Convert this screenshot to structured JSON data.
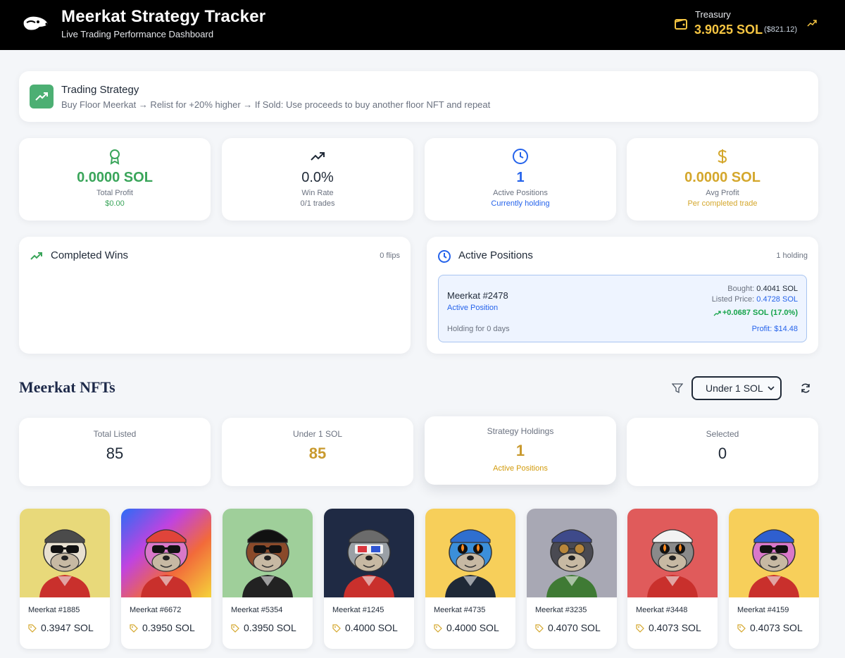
{
  "header": {
    "title": "Meerkat Strategy Tracker",
    "subtitle": "Live Trading Performance Dashboard",
    "treasury_label": "Treasury",
    "treasury_sol": "3.9025 SOL",
    "treasury_usd": "($821.12)"
  },
  "strategy": {
    "title": "Trading Strategy",
    "description": "Buy Floor Meerkat → Relist for +20% higher → If Sold: Use proceeds to buy another floor NFT and repeat"
  },
  "stats": [
    {
      "value": "0.0000 SOL",
      "label": "Total Profit",
      "sub": "$0.00",
      "icon": "award-icon",
      "color": "#3aa55a"
    },
    {
      "value": "0.0%",
      "label": "Win Rate",
      "sub": "0/1 trades",
      "icon": "trending-up-icon",
      "color": "#1f2937"
    },
    {
      "value": "1",
      "label": "Active Positions",
      "sub": "Currently holding",
      "icon": "clock-icon",
      "color": "#2563eb"
    },
    {
      "value": "0.0000 SOL",
      "label": "Avg Profit",
      "sub": "Per completed trade",
      "icon": "dollar-icon",
      "color": "#d4a72c"
    }
  ],
  "completed_wins": {
    "title": "Completed Wins",
    "count": "0 flips"
  },
  "active_positions": {
    "title": "Active Positions",
    "count": "1 holding",
    "position": {
      "name": "Meerkat #2478",
      "status": "Active Position",
      "holding": "Holding for 0 days",
      "bought_label": "Bought:",
      "bought_value": "0.4041 SOL",
      "listed_label": "Listed Price:",
      "listed_value": "0.4728 SOL",
      "gain": "+0.0687 SOL (17.0%)",
      "profit": "Profit: $14.48"
    }
  },
  "nfts": {
    "title": "Meerkat NFTs",
    "filter_selected": "Under 1 SOL",
    "summary": [
      {
        "label": "Total Listed",
        "value": "85",
        "sub": "",
        "color": "#1f2937"
      },
      {
        "label": "Under 1 SOL",
        "value": "85",
        "sub": "",
        "color": "#c99a2e"
      },
      {
        "label": "Strategy Holdings",
        "value": "1",
        "sub": "Active Positions",
        "color": "#c99a2e"
      },
      {
        "label": "Selected",
        "value": "0",
        "sub": "",
        "color": "#1f2937"
      }
    ],
    "items": [
      {
        "name": "Meerkat #1885",
        "price": "0.3947 SOL",
        "bg": "#e8d97a",
        "hat": "#4b4b4b",
        "shirt": "#c9302c",
        "fur": "#e8e0d0",
        "eyes": "shades"
      },
      {
        "name": "Meerkat #6672",
        "price": "0.3950 SOL",
        "bg": "rainbow",
        "hat": "#e0443a",
        "shirt": "#c9302c",
        "fur": "#d978c9",
        "eyes": "shades"
      },
      {
        "name": "Meerkat #5354",
        "price": "0.3950 SOL",
        "bg": "#9fcf9a",
        "hat": "#111111",
        "shirt": "#222222",
        "fur": "#8a4a2a",
        "eyes": "shades"
      },
      {
        "name": "Meerkat #1245",
        "price": "0.4000 SOL",
        "bg": "#1f2a44",
        "hat": "#6b6b6b",
        "shirt": "#c9302c",
        "fur": "#9aa0a6",
        "eyes": "3d"
      },
      {
        "name": "Meerkat #4735",
        "price": "0.4000 SOL",
        "bg": "#f7cf5a",
        "hat": "#2f6fcf",
        "shirt": "#1f2937",
        "fur": "#3b8fd9",
        "eyes": "fire"
      },
      {
        "name": "Meerkat #3235",
        "price": "0.4070 SOL",
        "bg": "#a8a8b4",
        "hat": "#3e4a8a",
        "shirt": "#3f7a34",
        "fur": "#4a4a52",
        "eyes": "round"
      },
      {
        "name": "Meerkat #3448",
        "price": "0.4073 SOL",
        "bg": "#e05b5b",
        "hat": "#f2f2f2",
        "shirt": "#c9302c",
        "fur": "#8a8a8a",
        "eyes": "fire"
      },
      {
        "name": "Meerkat #4159",
        "price": "0.4073 SOL",
        "bg": "#f7cf5a",
        "hat": "#2f5fcf",
        "shirt": "#c9302c",
        "fur": "#d978c9",
        "eyes": "shades"
      }
    ]
  }
}
